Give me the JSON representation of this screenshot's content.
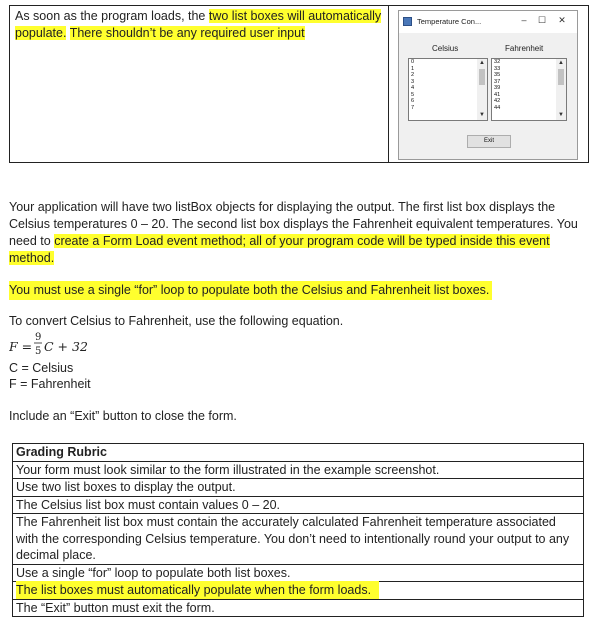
{
  "top_text": {
    "part1": "As soon as the program loads, the ",
    "part2": "two list boxes will automatically",
    "part3": "populate.",
    "part4": " ",
    "part5": "There shouldn’t be any required user input"
  },
  "window": {
    "title": "Temperature Con...",
    "btn_min": "–",
    "btn_max": "☐",
    "btn_close": "✕",
    "label_celsius": "Celsius",
    "label_fahrenheit": "Fahrenheit",
    "celsius_items": [
      "0",
      "1",
      "2",
      "3",
      "4",
      "5",
      "6",
      "7"
    ],
    "fahrenheit_items": [
      "32",
      "33",
      "35",
      "37",
      "39",
      "41",
      "42",
      "44"
    ],
    "exit_label": "Exit",
    "scroll_up": "▲",
    "scroll_down": "▼"
  },
  "paragraphs": {
    "p1_a": "Your application will have two listBox objects for displaying the output.  The first list box displays the Celsius temperatures 0 – 20.  The second list box displays the Fahrenheit equivalent temperatures.  You need to ",
    "p1_b": "create a Form Load event method; all of your program code will be typed inside this event method.",
    "p2": "You must use a single “for” loop to populate both the Celsius and Fahrenheit list boxes.",
    "p3": "To convert Celsius to Fahrenheit, use the following equation.",
    "p4": "C = Celsius",
    "p5": "F = Fahrenheit",
    "p6": "Include an “Exit” button to close the form."
  },
  "equation": {
    "lhs": "F =",
    "num": "9",
    "den": "5",
    "rhs": "C + 32"
  },
  "rubric": {
    "heading": "Grading Rubric",
    "rows": [
      "Your form must look similar to the form illustrated in the example screenshot.",
      "Use two list boxes to display the output.",
      "The Celsius list box must contain values 0 – 20.",
      "The Fahrenheit list box must contain the accurately calculated Fahrenheit temperature associated with the corresponding Celsius temperature.  You don’t need to intentionally round your output to any decimal place.",
      "Use a single “for” loop to populate both list boxes.",
      "The list boxes must automatically populate when the form loads.",
      "The “Exit” button must exit the form."
    ]
  },
  "colors": {
    "highlight": "#ffff2e",
    "window_icon": "#4a77b8"
  }
}
